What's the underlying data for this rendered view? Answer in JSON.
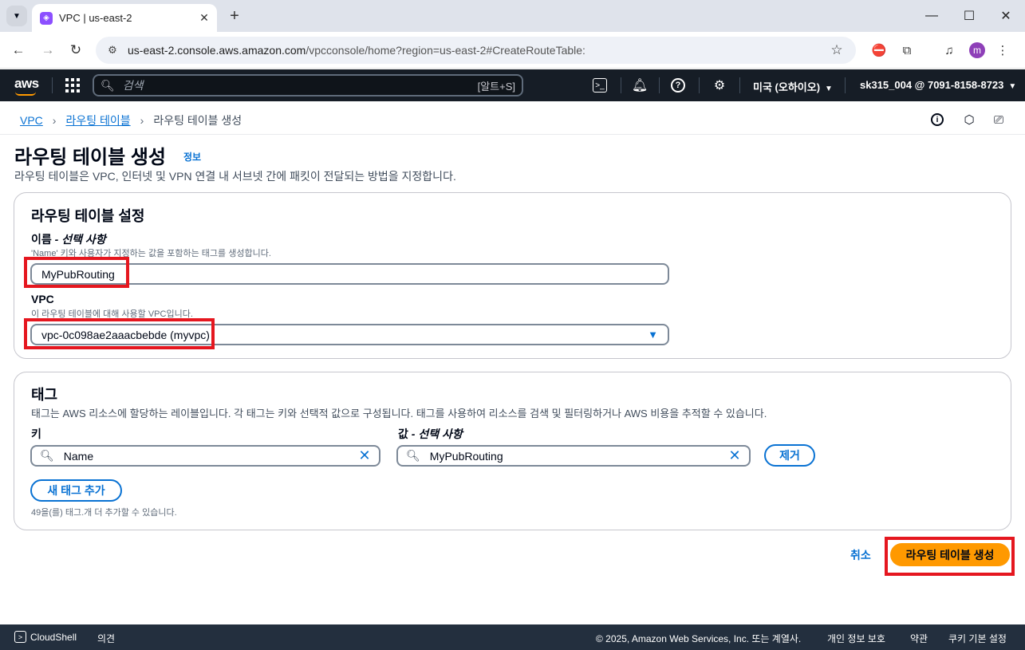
{
  "browser": {
    "tab_title": "VPC | us-east-2",
    "url_host": "us-east-2.console.aws.amazon.com",
    "url_path": "/vpcconsole/home?region=us-east-2#CreateRouteTable:",
    "profile_initial": "m"
  },
  "aws_nav": {
    "search_placeholder": "검색",
    "search_shortcut": "[알트+S]",
    "region": "미국 (오하이오)",
    "account": "sk315_004 @ 7091-8158-8723"
  },
  "breadcrumb": {
    "items": [
      "VPC",
      "라우팅 테이블"
    ],
    "current": "라우팅 테이블 생성"
  },
  "page": {
    "title": "라우팅 테이블 생성",
    "info_link": "정보",
    "description": "라우팅 테이블은 VPC, 인터넷 및 VPN 연결 내 서브넷 간에 패킷이 전달되는 방법을 지정합니다."
  },
  "settings": {
    "heading": "라우팅 테이블 설정",
    "name_label": "이름",
    "name_optional": " - 선택 사항",
    "name_hint": "'Name' 키와 사용자가 지정하는 값을 포함하는 태그를 생성합니다.",
    "name_value": "MyPubRouting",
    "vpc_label": "VPC",
    "vpc_hint": "이 라우팅 테이블에 대해 사용할 VPC입니다.",
    "vpc_value": "vpc-0c098ae2aaacbebde (myvpc)"
  },
  "tags": {
    "heading": "태그",
    "description": "태그는 AWS 리소스에 할당하는 레이블입니다. 각 태그는 키와 선택적 값으로 구성됩니다. 태그를 사용하여 리소스를 검색 및 필터링하거나 AWS 비용을 추적할 수 있습니다.",
    "key_label": "키",
    "value_label": "값",
    "value_optional": " - 선택 사항",
    "key_value": "Name",
    "value_value": "MyPubRouting",
    "remove_label": "제거",
    "add_label": "새 태그 추가",
    "remaining_hint": "49을(를) 태그.개 더 추가할 수 있습니다."
  },
  "actions": {
    "cancel": "취소",
    "create": "라우팅 테이블 생성"
  },
  "footer": {
    "cloudshell": "CloudShell",
    "feedback": "의견",
    "copyright": "© 2025, Amazon Web Services, Inc. 또는 계열사.",
    "privacy": "개인 정보 보호",
    "terms": "약관",
    "cookies": "쿠키 기본 설정"
  },
  "colors": {
    "aws_nav_bg": "#161d26",
    "link_blue": "#0972d3",
    "primary_orange": "#ff9900",
    "annotation_red": "#e5171f",
    "footer_bg": "#232f3e"
  }
}
